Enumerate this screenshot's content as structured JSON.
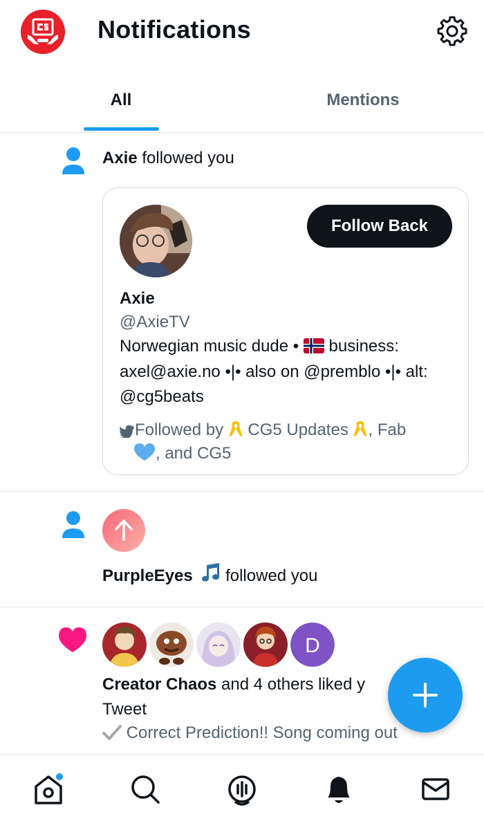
{
  "header": {
    "title": "Notifications",
    "brand_icon": "cg5-logo-icon",
    "settings_icon": "gear-icon",
    "brand_color": "#e8202a"
  },
  "tabs": [
    {
      "label": "All",
      "active": true
    },
    {
      "label": "Mentions",
      "active": false
    }
  ],
  "notifications": {
    "follow_1": {
      "icon": "person-icon",
      "name": "Axie",
      "action": "followed you",
      "card": {
        "name": "Axie",
        "handle": "@AxieTV",
        "bio_part1": "Norwegian music dude •",
        "bio_flag": "norway-flag-icon",
        "bio_part2": "business: axel@axie.no •|• also on @premblo •|• alt: @cg5beats",
        "follow_button": "Follow Back",
        "followed_by_prefix": "Followed by",
        "followed_by_name1": "CG5 Updates",
        "followed_by_sep": ", Fab",
        "followed_by_suffix": ", and CG5"
      }
    },
    "follow_2": {
      "icon": "person-icon",
      "avatar_icon": "up-arrow-icon",
      "name": "PurpleEyes",
      "action": "followed you"
    },
    "likes": {
      "icon": "heart-icon",
      "avatar_letter": "D",
      "name": "Creator Chaos",
      "action": "and 4 others liked y",
      "action_line2": "Tweet",
      "preview": "Correct Prediction!! Song coming out"
    }
  },
  "fab": {
    "icon": "plus-icon"
  },
  "bottom_nav": [
    {
      "name": "home",
      "icon": "home-icon"
    },
    {
      "name": "search",
      "icon": "search-icon"
    },
    {
      "name": "spaces",
      "icon": "spaces-icon"
    },
    {
      "name": "notifications",
      "icon": "bell-icon"
    },
    {
      "name": "messages",
      "icon": "mail-icon"
    }
  ],
  "colors": {
    "accent": "#1d9bf0",
    "like": "#f91880",
    "secondary_text": "#536471",
    "divider": "#e1e6ea"
  }
}
